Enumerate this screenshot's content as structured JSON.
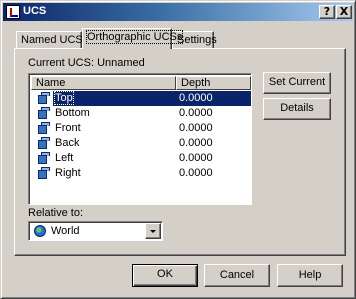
{
  "window": {
    "title": "UCS",
    "help_glyph": "?",
    "close_glyph": "X"
  },
  "tabs": [
    {
      "label": "Named UCSs"
    },
    {
      "label": "Orthographic UCSs"
    },
    {
      "label": "Settings"
    }
  ],
  "current_ucs": {
    "label": "Current UCS:",
    "value": "Unnamed",
    "text": "Current UCS:  Unnamed"
  },
  "list": {
    "columns": [
      "Name",
      "Depth"
    ],
    "rows": [
      {
        "name": "Top",
        "depth": "0.0000",
        "icon": "ucs-top-icon",
        "selected": true
      },
      {
        "name": "Bottom",
        "depth": "0.0000",
        "icon": "ucs-bottom-icon",
        "selected": false
      },
      {
        "name": "Front",
        "depth": "0.0000",
        "icon": "ucs-front-icon",
        "selected": false
      },
      {
        "name": "Back",
        "depth": "0.0000",
        "icon": "ucs-back-icon",
        "selected": false
      },
      {
        "name": "Left",
        "depth": "0.0000",
        "icon": "ucs-left-icon",
        "selected": false
      },
      {
        "name": "Right",
        "depth": "0.0000",
        "icon": "ucs-right-icon",
        "selected": false
      }
    ]
  },
  "side_buttons": {
    "set_current": "Set Current",
    "details": "Details"
  },
  "relative_to": {
    "label": "Relative to:",
    "selected": "World"
  },
  "footer": {
    "ok": "OK",
    "cancel": "Cancel",
    "help": "Help"
  },
  "colors": {
    "title_start": "#0a246a",
    "title_end": "#a6caf0",
    "selection": "#0a246a",
    "face": "#d4d0c8"
  }
}
